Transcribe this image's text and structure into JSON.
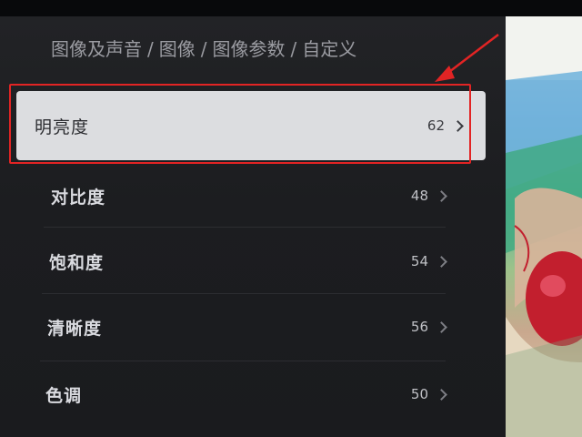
{
  "breadcrumb": {
    "items": [
      "图像及声音",
      "图像",
      "图像参数",
      "自定义"
    ],
    "separator": "/"
  },
  "settings": [
    {
      "label": "明亮度",
      "value": "62"
    },
    {
      "label": "对比度",
      "value": "48"
    },
    {
      "label": "饱和度",
      "value": "54"
    },
    {
      "label": "清晰度",
      "value": "56"
    },
    {
      "label": "色调",
      "value": "50"
    }
  ],
  "selected_index": 0,
  "colors": {
    "panel_bg": "#1e1f22",
    "selected_bg": "#dcdde0",
    "annotation": "#e22424"
  },
  "icons": {
    "row_chevron": "chevron-right-icon"
  }
}
